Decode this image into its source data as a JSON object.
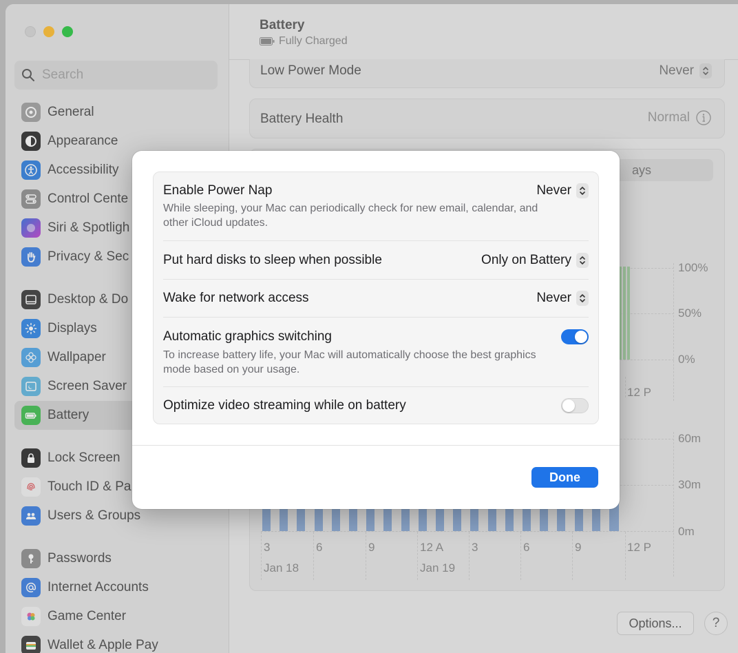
{
  "window": {
    "title": "Battery",
    "subtitle": "Fully Charged"
  },
  "search": {
    "placeholder": "Search"
  },
  "sidebar": {
    "items": [
      {
        "label": "General",
        "icon": "gear-icon",
        "color": "#a0a0a0"
      },
      {
        "label": "Appearance",
        "icon": "appearance-icon",
        "color": "#2b2b2b"
      },
      {
        "label": "Accessibility",
        "icon": "accessibility-icon",
        "color": "#2f7fe0"
      },
      {
        "label": "Control Cente",
        "icon": "control-center-icon",
        "color": "#8e8e8e"
      },
      {
        "label": "Siri & Spotligh",
        "icon": "siri-icon",
        "color": "#7b5cd6"
      },
      {
        "label": "Privacy & Sec",
        "icon": "hand-icon",
        "color": "#3a7ee2"
      },
      {
        "label": "Desktop & Do",
        "icon": "desktop-icon",
        "color": "#3a3a3a"
      },
      {
        "label": "Displays",
        "icon": "sun-icon",
        "color": "#2f86e6"
      },
      {
        "label": "Wallpaper",
        "icon": "flower-icon",
        "color": "#4fa7e8"
      },
      {
        "label": "Screen Saver",
        "icon": "screensaver-icon",
        "color": "#5fb6e0"
      },
      {
        "label": "Battery",
        "icon": "battery-icon",
        "color": "#3fbf4f"
      },
      {
        "label": "Lock Screen",
        "icon": "lock-icon",
        "color": "#2b2b2b"
      },
      {
        "label": "Touch ID & Pa",
        "icon": "fingerprint-icon",
        "color": "#f2f2f2"
      },
      {
        "label": "Users & Groups",
        "icon": "users-icon",
        "color": "#3a7ee2"
      },
      {
        "label": "Passwords",
        "icon": "key-icon",
        "color": "#8e8e8e"
      },
      {
        "label": "Internet Accounts",
        "icon": "at-icon",
        "color": "#3a7ee2"
      },
      {
        "label": "Game Center",
        "icon": "game-center-icon",
        "color": "#f2f2f2"
      },
      {
        "label": "Wallet & Apple Pay",
        "icon": "wallet-icon",
        "color": "#3a3a3a"
      }
    ],
    "selected": "Battery"
  },
  "main": {
    "low_power": {
      "label": "Low Power Mode",
      "value": "Never"
    },
    "battery_health": {
      "label": "Battery Health",
      "value": "Normal"
    },
    "segment_fragment": "ays",
    "level_chart": {
      "y_ticks": [
        "100%",
        "50%",
        "0%"
      ],
      "x_tick": "12 P"
    },
    "usage_chart": {
      "y_ticks": [
        "60m",
        "30m",
        "0m"
      ],
      "x_ticks": [
        "3",
        "6",
        "9",
        "12 A",
        "3",
        "6",
        "9",
        "12 P"
      ],
      "date_labels": [
        "Jan 18",
        "Jan 19"
      ]
    },
    "options_label": "Options...",
    "help_label": "?"
  },
  "dialog": {
    "rows": [
      {
        "label": "Enable Power Nap",
        "value": "Never",
        "description": "While sleeping, your Mac can periodically check for new email, calendar, and other iCloud updates."
      },
      {
        "label": "Put hard disks to sleep when possible",
        "value": "Only on Battery"
      },
      {
        "label": "Wake for network access",
        "value": "Never"
      },
      {
        "label": "Automatic graphics switching",
        "toggle": true,
        "description": "To increase battery life, your Mac will automatically choose the best graphics mode based on your usage."
      },
      {
        "label": "Optimize video streaming while on battery",
        "toggle": false
      }
    ],
    "done_label": "Done"
  },
  "colors": {
    "accent": "#1f74e8",
    "battery_green": "#a9d6a6",
    "usage_blue": "#8aaad6"
  }
}
